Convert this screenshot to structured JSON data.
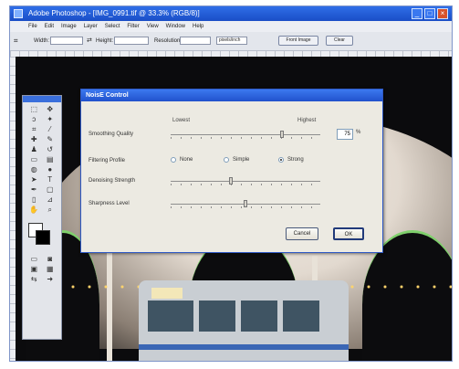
{
  "window": {
    "title": "Adobe Photoshop - [IMG_0991.tif @ 33.3% (RGB/8)]"
  },
  "menu": [
    "File",
    "Edit",
    "Image",
    "Layer",
    "Select",
    "Filter",
    "View",
    "Window",
    "Help"
  ],
  "options": {
    "width_label": "Width:",
    "height_label": "Height:",
    "resolution_label": "Resolution:",
    "resolution_unit": "pixels/inch",
    "front_image_button": "Front Image",
    "clear_button": "Clear"
  },
  "dialog": {
    "title": "NoisE Control",
    "scale_low": "Lowest",
    "scale_high": "Highest",
    "rows": {
      "smoothing": "Smoothing Quality",
      "filtering": "Filtering Profile",
      "sharpening": "Denoising Strength",
      "sharpness": "Sharpness Level"
    },
    "smoothing_value": "75",
    "percent_sign": "%",
    "filtering_options": [
      "None",
      "Simple",
      "Strong"
    ],
    "filtering_selected": "Strong",
    "slider_levels": {
      "smoothing": 0.75,
      "sharpening": 0.4,
      "sharpness": 0.5
    },
    "cancel_button": "Cancel",
    "ok_button": "OK"
  },
  "colors": {
    "accent": "#2a5fd8",
    "canvas": "#0b0b0d"
  }
}
